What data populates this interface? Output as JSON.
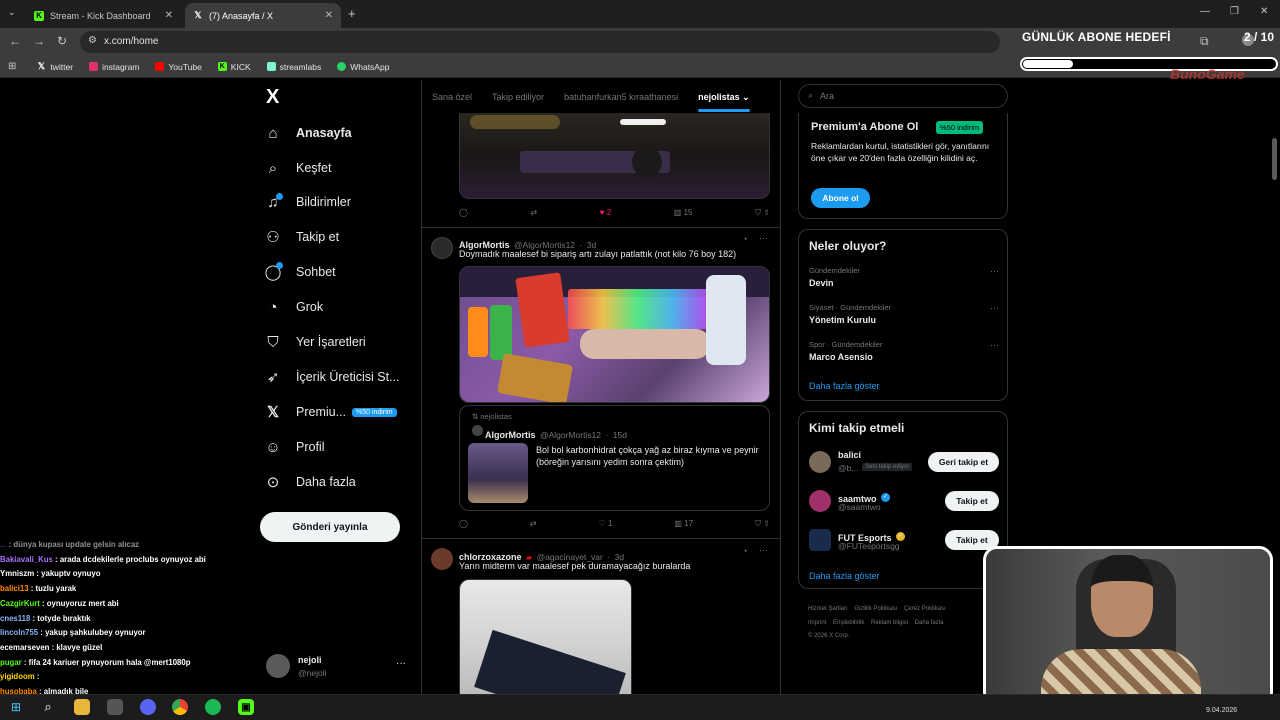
{
  "browser": {
    "tabs": [
      {
        "title": "Stream - Kick Dashboard",
        "active": false
      },
      {
        "title": "(7) Anasayfa / X",
        "active": true
      }
    ],
    "new_tab": "+",
    "url": "x.com/home",
    "bookmarks": [
      {
        "label": "twitter",
        "color": "#000000"
      },
      {
        "label": "instagram",
        "color": "#e1306c"
      },
      {
        "label": "YouTube",
        "color": "#ff0000"
      },
      {
        "label": "KICK",
        "color": "#53fc18"
      },
      {
        "label": "streamlabs",
        "color": "#80f5d2"
      },
      {
        "label": "WhatsApp",
        "color": "#25d366"
      }
    ]
  },
  "overlay": {
    "goal_title": "GÜNLÜK ABONE HEDEFİ",
    "goal_count": "2 / 10",
    "goal_progress": 0.2,
    "brand": "BunoGame"
  },
  "sidebar": {
    "logo": "X",
    "items": [
      {
        "label": "Anasayfa",
        "icon": "home-icon",
        "bold": true
      },
      {
        "label": "Keşfet",
        "icon": "search-icon"
      },
      {
        "label": "Bildirimler",
        "icon": "bell-icon",
        "badge": true
      },
      {
        "label": "Takip et",
        "icon": "add-person-icon"
      },
      {
        "label": "Sohbet",
        "icon": "chat-icon",
        "badge": true
      },
      {
        "label": "Grok",
        "icon": "grok-icon"
      },
      {
        "label": "Yer İşaretleri",
        "icon": "bookmark-icon"
      },
      {
        "label": "İçerik Üreticisi St...",
        "icon": "rocket-icon"
      },
      {
        "label": "Premiu...",
        "icon": "x-icon",
        "pill": "%50 indirim"
      },
      {
        "label": "Profil",
        "icon": "person-icon"
      },
      {
        "label": "Daha fazla",
        "icon": "more-circle-icon"
      }
    ],
    "post_button": "Gönderi yayınla",
    "account": {
      "name": "nejoli",
      "handle": "@nejoli"
    }
  },
  "feed": {
    "tabs": [
      "Sana özel",
      "Takip ediliyor",
      "batuhanfurkan5 kıraathanesi",
      "nejolistas"
    ],
    "active_tab": "nejolistas",
    "posts": [
      {
        "actions": {
          "replies": "",
          "reposts": "",
          "likes": "2",
          "views": "15"
        }
      },
      {
        "name": "AlgorMortis",
        "handle": "@AlgorMortis12",
        "time": "3d",
        "text": "Doymadık maalesef bi sipariş artı zulayı patlattık (not kilo 76 boy 182)",
        "quote": {
          "list": "nejolistas",
          "name": "AlgorMortis",
          "handle": "@AlgorMortis12",
          "time": "15d",
          "text": "Bol bol karbonhidrat çokça yağ az biraz kıyma ve peynir (böreğin yarısını yedim sonra çektim)"
        },
        "actions": {
          "replies": "",
          "reposts": "",
          "likes": "1",
          "views": "17"
        }
      },
      {
        "name": "chlorzoxazone",
        "handle": "@agacinayet_var",
        "time": "3d",
        "text": "Yarın midterm var maalesef pek duramayacağız buralarda"
      }
    ]
  },
  "right": {
    "search_placeholder": "Ara",
    "premium": {
      "title": "Premium'a Abone Ol",
      "pill": "%50 indirim",
      "text": "Reklamlardan kurtul, istatistikleri gör, yanıtlarını öne çıkar ve 20'den fazla özelliğin kilidini aç.",
      "button": "Abone ol"
    },
    "trends": {
      "title": "Neler oluyor?",
      "items": [
        {
          "context": "Gündemdekiler",
          "name": "Devin"
        },
        {
          "context": "Siyaset · Gündemdekiler",
          "name": "Yönetim Kurulu"
        },
        {
          "context": "Spor · Gündemdekiler",
          "name": "Marco Asensio"
        }
      ],
      "more": "Daha fazla göster"
    },
    "who_to_follow": {
      "title": "Kimi takip etmeli",
      "items": [
        {
          "name": "balici",
          "handle": "@b...",
          "tag": "Seni takip ediyor",
          "button": "Geri takip et"
        },
        {
          "name": "saamtwo",
          "handle": "@saamtwo",
          "verified": "blue",
          "button": "Takip et"
        },
        {
          "name": "FUT Esports",
          "handle": "@FUTesportsgg",
          "verified": "gold",
          "button": "Takip et"
        }
      ],
      "more": "Daha fazla göster"
    },
    "footer": [
      "Hizmet Şartları",
      "Gizlilik Politikası",
      "Çerez Politikası",
      "Imprint",
      "Erişilebilirlik",
      "Reklam bilgisi",
      "Daha fazla",
      "© 2026 X Corp."
    ]
  },
  "chat": [
    {
      "user": "...",
      "msg": ": dünya kupası update gelsin alıcaz",
      "color": "#9146ff",
      "faded": true
    },
    {
      "user": "Bakiavali_Kus",
      "msg": ": arada dcdekilerle proclubs oynuyoz abi",
      "color": "#a970ff"
    },
    {
      "user": "Ymniszm",
      "msg": ": yakuptv oynuyo",
      "color": "#ffffff"
    },
    {
      "user": "balici13",
      "msg": ": tuzlu yarak",
      "color": "#ff8c00"
    },
    {
      "user": "CazgirKurt",
      "msg": ": oynuyoruz mert abi",
      "color": "#53fc18"
    },
    {
      "user": "cnes118",
      "msg": ": totyde bıraktık",
      "color": "#8ab4f8"
    },
    {
      "user": "lincoln755",
      "msg": ": yakup şahkulubey oynuyor",
      "color": "#8ab4f8"
    },
    {
      "user": "ecemarseven",
      "msg": ": klavye güzel",
      "color": "#ffffff"
    },
    {
      "user": "pugar",
      "msg": ": fifa 24 kariuer pynuyorum hala @mert1080p",
      "color": "#53fc18"
    },
    {
      "user": "yigidoom",
      "msg": ":",
      "color": "#ffd700"
    },
    {
      "user": "husobaba",
      "msg": ": almadık bile",
      "color": "#ff8c00"
    }
  ],
  "taskbar": {
    "date": "9.04.2026"
  }
}
